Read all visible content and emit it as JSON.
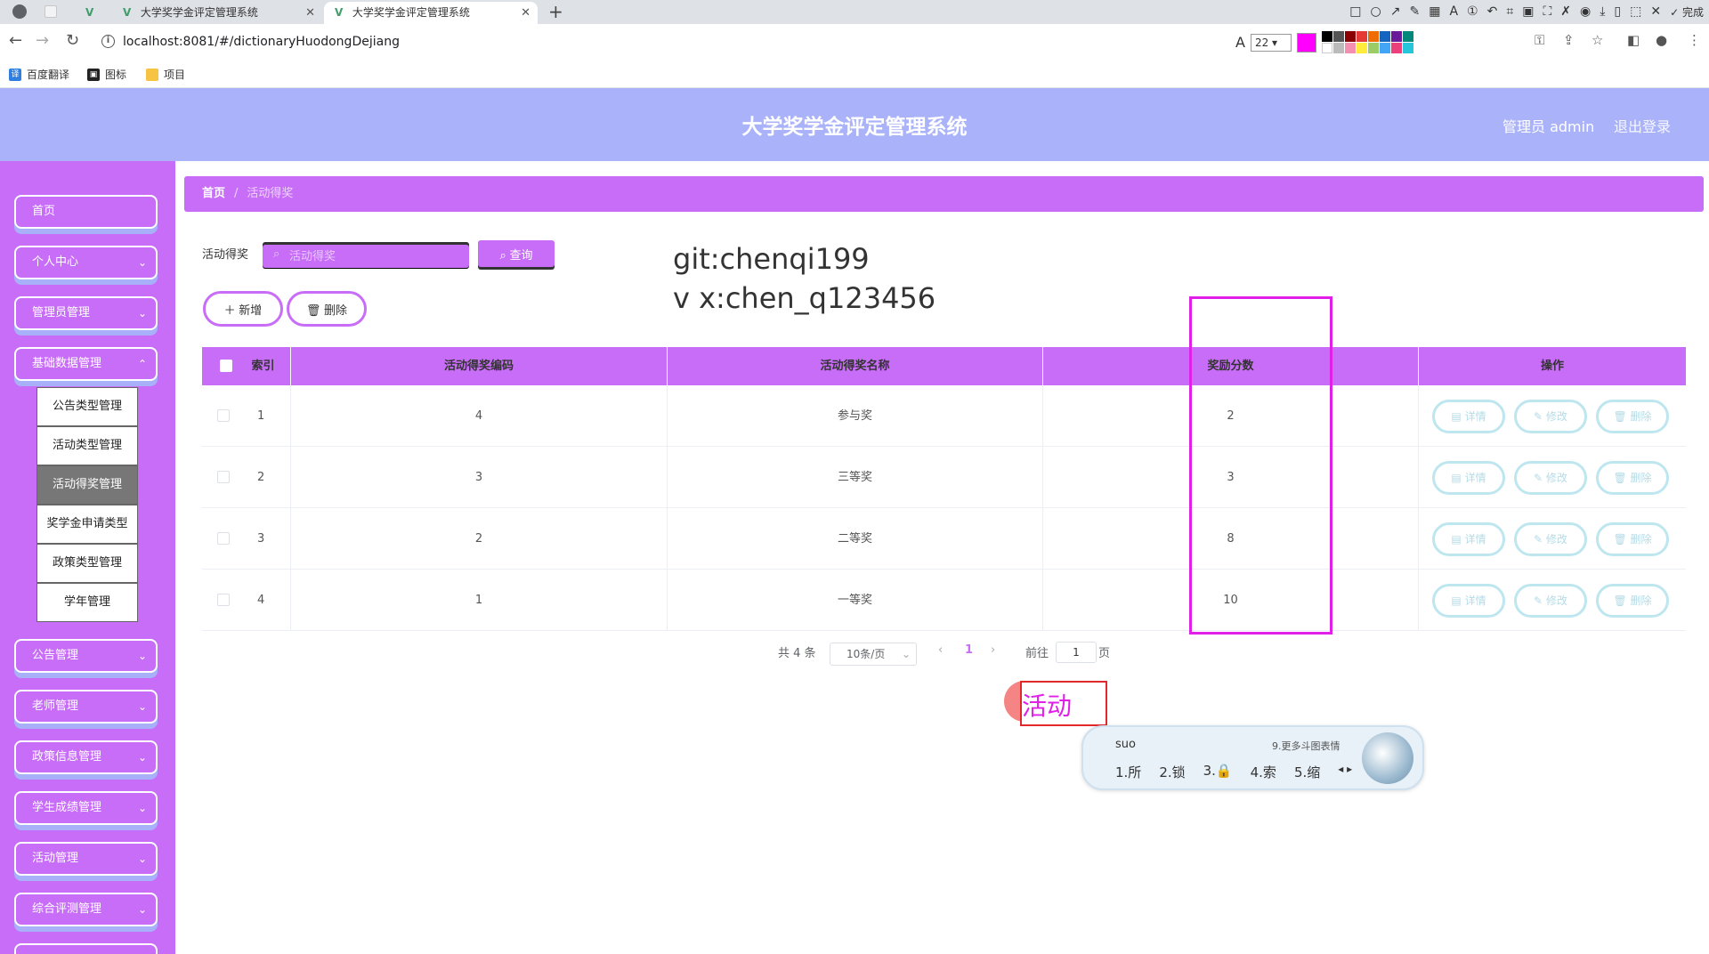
{
  "browser": {
    "tabs": [
      {
        "title": "大学奖学金评定管理系统",
        "active": false
      },
      {
        "title": "大学奖学金评定管理系统",
        "active": true
      }
    ],
    "new_tab": "+",
    "done_label": "完成",
    "url": "localhost:8081/#/dictionaryHuodongDejiang",
    "font_size": "22",
    "annotation_color": "#ff00ff",
    "bookmarks": [
      "百度翻译",
      "图标",
      "项目"
    ]
  },
  "header": {
    "title": "大学奖学金评定管理系统",
    "admin": "管理员 admin",
    "logout": "退出登录"
  },
  "sidebar": {
    "items": [
      {
        "label": "首页",
        "chevron": false
      },
      {
        "label": "个人中心",
        "chevron": true
      },
      {
        "label": "管理员管理",
        "chevron": true
      },
      {
        "label": "基础数据管理",
        "chevron": true,
        "expanded": true
      },
      {
        "label": "公告管理",
        "chevron": true
      },
      {
        "label": "老师管理",
        "chevron": true
      },
      {
        "label": "政策信息管理",
        "chevron": true
      },
      {
        "label": "学生成绩管理",
        "chevron": true
      },
      {
        "label": "活动管理",
        "chevron": true
      },
      {
        "label": "综合评测管理",
        "chevron": true
      }
    ],
    "submenu": [
      {
        "label": "公告类型管理",
        "active": false
      },
      {
        "label": "活动类型管理",
        "active": false
      },
      {
        "label": "活动得奖管理",
        "active": true
      },
      {
        "label": "奖学金申请类型",
        "active": false
      },
      {
        "label": "政策类型管理",
        "active": false
      },
      {
        "label": "学年管理",
        "active": false
      }
    ]
  },
  "breadcrumb": {
    "home": "首页",
    "sep": "/",
    "current": "活动得奖"
  },
  "search": {
    "label": "活动得奖",
    "placeholder": "活动得奖",
    "button": "查询"
  },
  "actions": {
    "add": "新增",
    "delete": "删除"
  },
  "watermark": {
    "line1": "git:chenqi199",
    "line2": "v x:chen_q123456"
  },
  "table": {
    "columns": [
      "索引",
      "活动得奖编码",
      "活动得奖名称",
      "奖励分数",
      "操作"
    ],
    "rows": [
      {
        "index": "1",
        "code": "4",
        "name": "参与奖",
        "score": "2"
      },
      {
        "index": "2",
        "code": "3",
        "name": "三等奖",
        "score": "3"
      },
      {
        "index": "3",
        "code": "2",
        "name": "二等奖",
        "score": "8"
      },
      {
        "index": "4",
        "code": "1",
        "name": "一等奖",
        "score": "10"
      }
    ],
    "row_actions": {
      "detail": "详情",
      "edit": "修改",
      "delete": "删除"
    }
  },
  "pagination": {
    "total": "共 4 条",
    "page_size": "10条/页",
    "current_page": "1",
    "goto_label": "前往",
    "goto_value": "1",
    "page_suffix": "页"
  },
  "ime": {
    "composing": "活动",
    "input": "suo",
    "more": "9.更多斗图表情",
    "candidates": [
      "1.所",
      "2.锁",
      "3.🔒",
      "4.索",
      "5.缩"
    ]
  },
  "colors": {
    "accent": "#c86df8",
    "header": "#aab3fa",
    "highlight": "#e020e8"
  }
}
